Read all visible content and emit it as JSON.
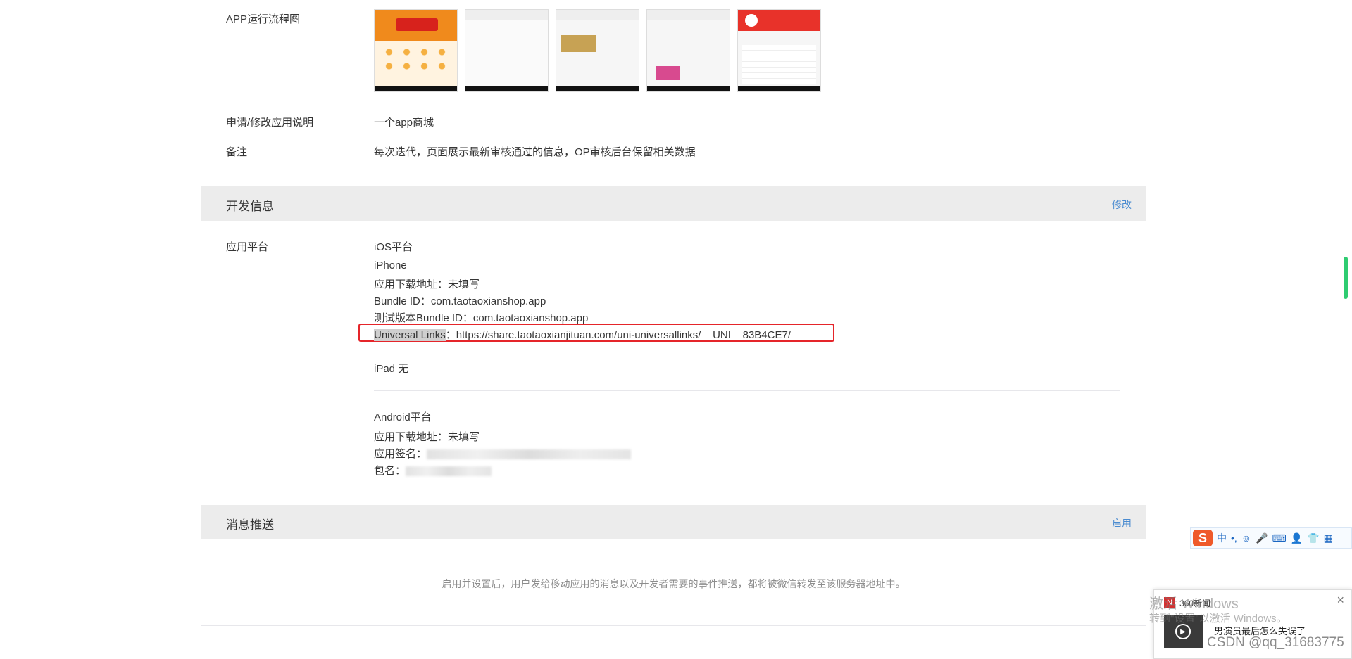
{
  "basic": {
    "flow_label": "APP运行流程图",
    "desc_label": "申请/修改应用说明",
    "desc_value": "一个app商城",
    "note_label": "备注",
    "note_value": "每次迭代，页面展示最新审核通过的信息，OP审核后台保留相关数据"
  },
  "dev": {
    "title": "开发信息",
    "edit": "修改",
    "platform_label": "应用平台",
    "ios_title": "iOS平台",
    "iphone": "iPhone",
    "download_label": "应用下载地址：",
    "download_value": "未填写",
    "bundle_label": "Bundle ID：",
    "bundle_value": "com.taotaoxianshop.app",
    "test_bundle_label": "测试版本Bundle ID：",
    "test_bundle_value": "com.taotaoxianshop.app",
    "ul_label": "Universal Links",
    "ul_sep": "：",
    "ul_value": "https://share.taotaoxianjituan.com/uni-universallinks/__UNI__83B4CE7/",
    "ipad": "iPad 无",
    "android_title": "Android平台",
    "android_download_label": "应用下载地址：",
    "android_download_value": "未填写",
    "sign_label": "应用签名：",
    "package_label": "包名："
  },
  "push": {
    "title": "消息推送",
    "enable": "启用",
    "desc": "启用并设置后，用户发给移动应用的消息以及开发者需要的事件推送，都将被微信转发至该服务器地址中。"
  },
  "ime": {
    "logo": "S",
    "lang": "中",
    "punct": "•,"
  },
  "notify": {
    "source": "360新闻",
    "headline": "男演员最后怎么失误了",
    "close": "×"
  },
  "overlay": {
    "watermark1": "激活 Windows",
    "watermark2": "转到\"设置\"以激活 Windows。",
    "csdn": "CSDN @qq_31683775"
  }
}
